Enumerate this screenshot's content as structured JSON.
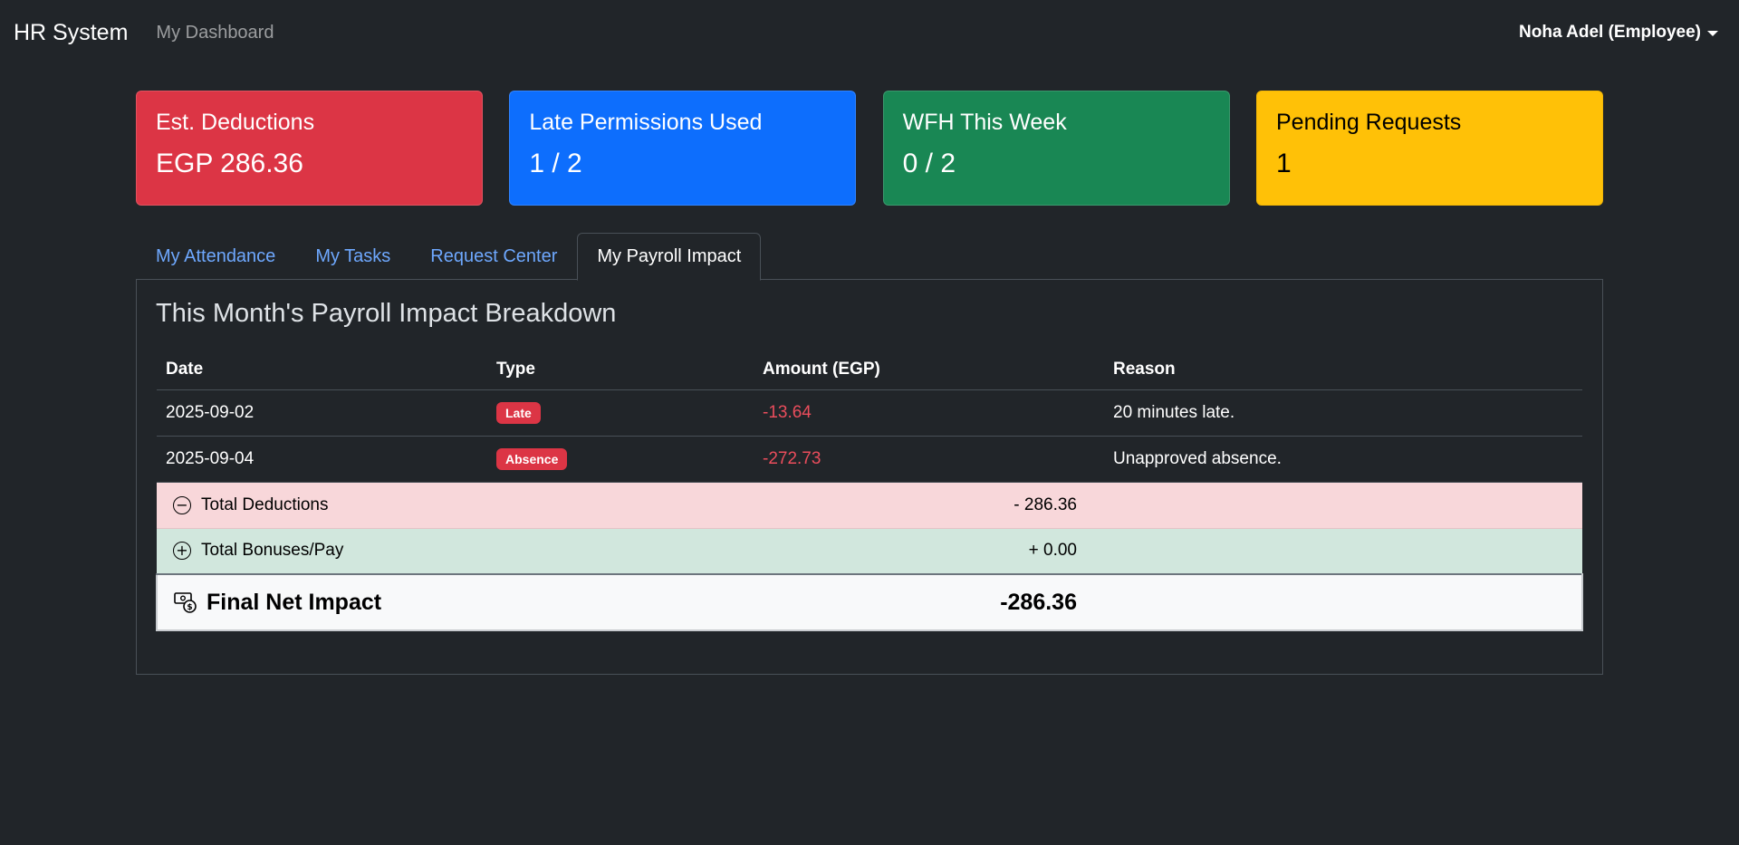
{
  "navbar": {
    "brand": "HR System",
    "dashboard_link": "My Dashboard",
    "user": "Noha Adel (Employee)"
  },
  "cards": [
    {
      "title": "Est. Deductions",
      "value": "EGP 286.36",
      "color": "#dc3545"
    },
    {
      "title": "Late Permissions Used",
      "value": "1 / 2",
      "color": "#0d6efd"
    },
    {
      "title": "WFH This Week",
      "value": "0 / 2",
      "color": "#198754"
    },
    {
      "title": "Pending Requests",
      "value": "1",
      "color": "#ffc107"
    }
  ],
  "tabs": [
    {
      "label": "My Attendance",
      "active": false
    },
    {
      "label": "My Tasks",
      "active": false
    },
    {
      "label": "Request Center",
      "active": false
    },
    {
      "label": "My Payroll Impact",
      "active": true
    }
  ],
  "payroll": {
    "title": "This Month's Payroll Impact Breakdown",
    "columns": [
      "Date",
      "Type",
      "Amount (EGP)",
      "Reason"
    ],
    "rows": [
      {
        "date": "2025-09-02",
        "type": "Late",
        "amount": "-13.64",
        "reason": "20 minutes late."
      },
      {
        "date": "2025-09-04",
        "type": "Absence",
        "amount": "-272.73",
        "reason": "Unapproved absence."
      }
    ],
    "total_deductions": {
      "label": "Total Deductions",
      "amount": "- 286.36",
      "icon": "dash-circle-icon"
    },
    "total_bonuses": {
      "label": "Total Bonuses/Pay",
      "amount": "+ 0.00",
      "icon": "plus-circle-icon"
    },
    "net": {
      "label": "Final Net Impact",
      "amount": "-286.36",
      "icon": "cash-coin-icon"
    }
  }
}
